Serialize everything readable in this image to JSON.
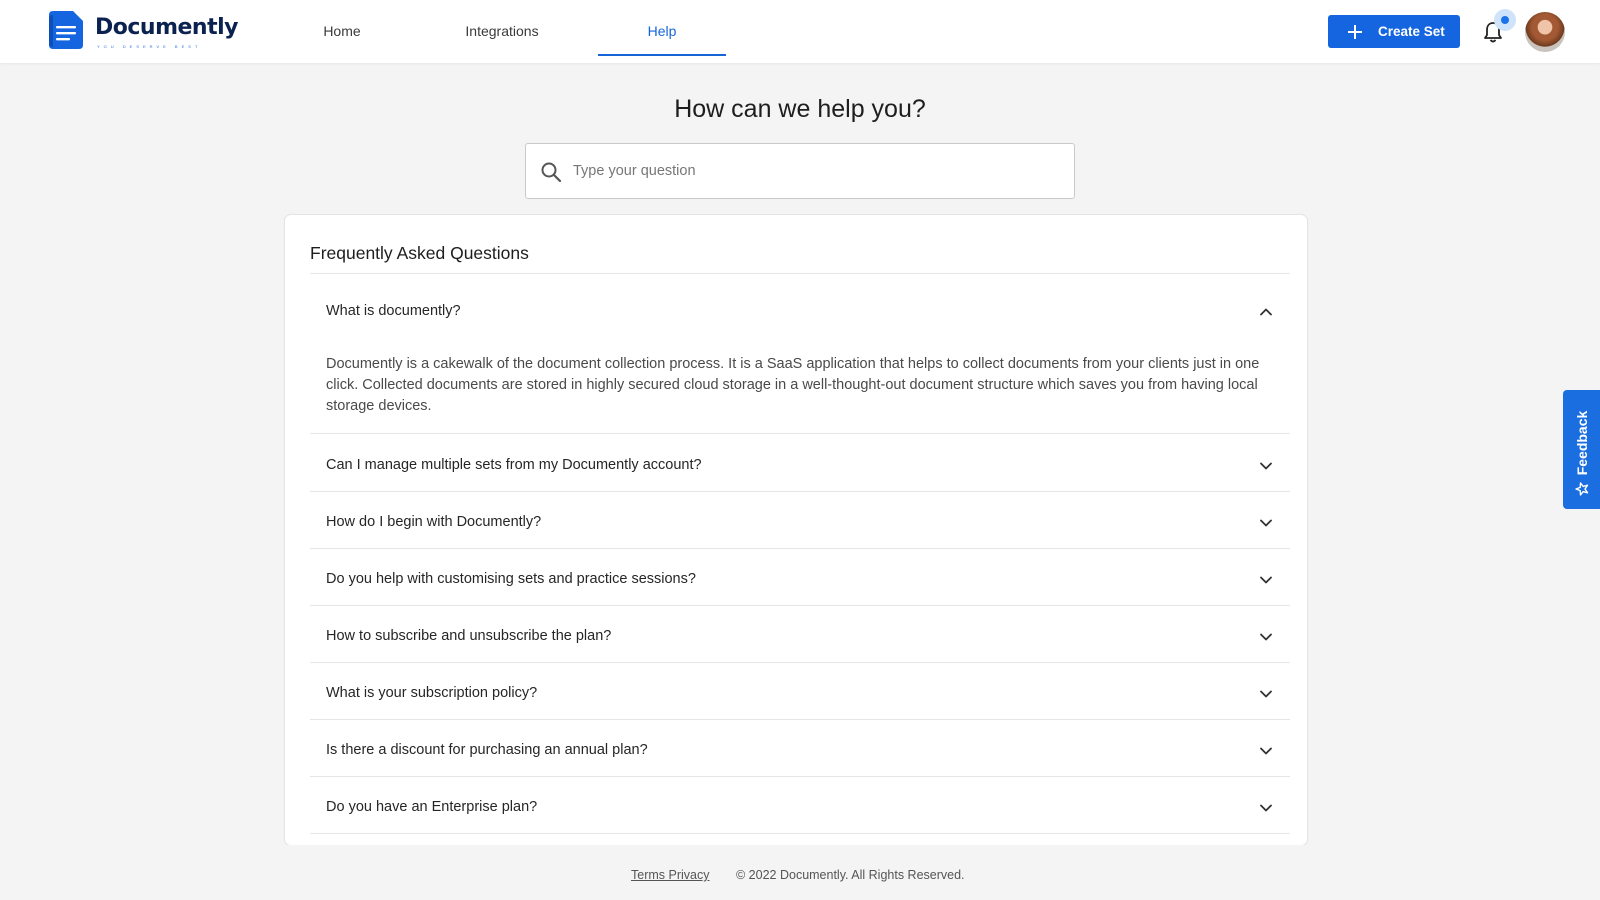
{
  "brand": {
    "name": "Documently",
    "tagline": "YOU DESERVE BEST",
    "primary_color": "#1565e0",
    "logo_icon": "document-lines-icon"
  },
  "nav": {
    "items": [
      {
        "label": "Home",
        "active": false
      },
      {
        "label": "Integrations",
        "active": false
      },
      {
        "label": "Help",
        "active": true
      }
    ]
  },
  "header_actions": {
    "create_label": "Create Set",
    "create_icon": "plus-icon",
    "notification_icon": "bell-icon",
    "notification_badge": true,
    "avatar_icon": "user-avatar"
  },
  "help": {
    "title": "How can we help you?",
    "search_placeholder": "Type your question",
    "search_value": "",
    "search_icon": "search-icon"
  },
  "faq": {
    "title": "Frequently Asked Questions",
    "items": [
      {
        "question": "What is documently?",
        "expanded": true,
        "answer": "Documently is a cakewalk of the document collection process. It is a SaaS application that helps to collect documents from your clients just in one click. Collected documents are stored in highly secured cloud storage in a well-thought-out document structure which saves you from having local storage devices."
      },
      {
        "question": "Can I manage multiple sets from my Documently account?",
        "expanded": false
      },
      {
        "question": "How do I begin with Documently?",
        "expanded": false
      },
      {
        "question": "Do you help with customising sets and practice sessions?",
        "expanded": false
      },
      {
        "question": "How to subscribe and unsubscribe the plan?",
        "expanded": false
      },
      {
        "question": "What is your subscription policy?",
        "expanded": false
      },
      {
        "question": "Is there a discount for purchasing an annual plan?",
        "expanded": false
      },
      {
        "question": "Do you have an Enterprise plan?",
        "expanded": false
      }
    ]
  },
  "feedback": {
    "label": "Feedback",
    "icon": "star-sparkle-icon",
    "color": "#1a6ee0"
  },
  "footer": {
    "links": "Terms Privacy",
    "copyright": "© 2022 Documently. All Rights Reserved."
  }
}
